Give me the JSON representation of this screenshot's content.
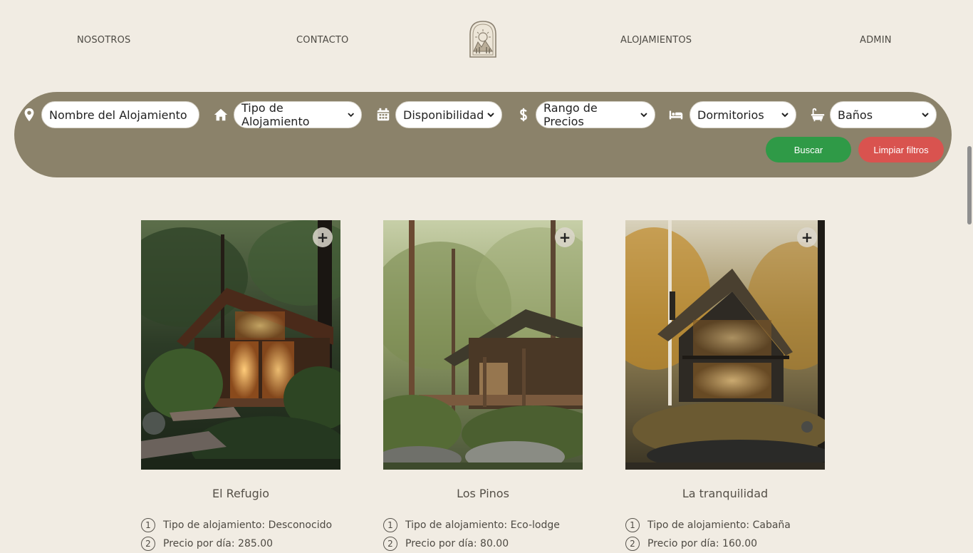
{
  "nav": {
    "nosotros": "NOSOTROS",
    "contacto": "CONTACTO",
    "alojamientos": "ALOJAMIENTOS",
    "admin": "ADMIN"
  },
  "filters": {
    "name_placeholder": "Nombre del Alojamiento",
    "tipo": "Tipo de Alojamiento",
    "disponibilidad": "Disponibilidad",
    "precios": "Rango de Precios",
    "dormitorios": "Dormitorios",
    "banos": "Baños",
    "buscar": "Buscar",
    "limpiar": "Limpiar filtros"
  },
  "colors": {
    "bar": "#8b826a",
    "buscar": "#2f9a47",
    "limpiar": "#d9534f",
    "background": "#f1ece3"
  },
  "cards": [
    {
      "title": "El Refugio",
      "add": "+",
      "info": [
        {
          "n": "1",
          "text": "Tipo de alojamiento: Desconocido"
        },
        {
          "n": "2",
          "text": "Precio por día: 285.00"
        }
      ]
    },
    {
      "title": "Los Pinos",
      "add": "+",
      "info": [
        {
          "n": "1",
          "text": "Tipo de alojamiento: Eco-lodge"
        },
        {
          "n": "2",
          "text": "Precio por día: 80.00"
        }
      ]
    },
    {
      "title": "La tranquilidad",
      "add": "+",
      "info": [
        {
          "n": "1",
          "text": "Tipo de alojamiento: Cabaña"
        },
        {
          "n": "2",
          "text": "Precio por día: 160.00"
        }
      ]
    }
  ]
}
